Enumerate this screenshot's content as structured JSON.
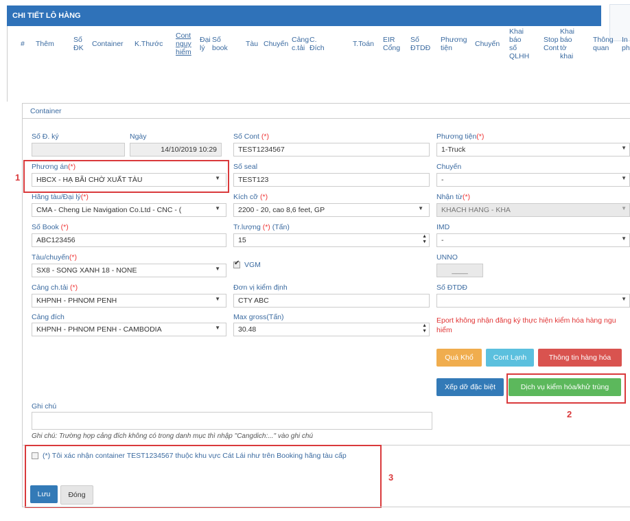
{
  "header": {
    "title": "CHI TIẾT LÔ HÀNG"
  },
  "table_headers": [
    {
      "line1": "#",
      "line2": "",
      "line3": "",
      "line4": "",
      "key": "hash"
    },
    {
      "line1": "Thêm",
      "line2": "",
      "line3": "",
      "line4": "",
      "key": "them"
    },
    {
      "line1": "Số",
      "line2": "ĐK",
      "line3": "",
      "line4": "",
      "key": "so_dk"
    },
    {
      "line1": "Container",
      "line2": "",
      "line3": "",
      "line4": "",
      "key": "container"
    },
    {
      "line1": "K.Thước",
      "line2": "",
      "line3": "",
      "line4": "",
      "key": "kthuoc"
    },
    {
      "line1": "Cont",
      "line2": "nguy",
      "line3": "hiểm",
      "line4": "",
      "key": "cont_nguy_hiem"
    },
    {
      "line1": "Đại",
      "line2": "lý",
      "line3": "",
      "line4": "",
      "key": "dai_ly"
    },
    {
      "line1": "Số",
      "line2": "book",
      "line3": "",
      "line4": "",
      "key": "so_book"
    },
    {
      "line1": "Tàu",
      "line2": "",
      "line3": "",
      "line4": "",
      "key": "tau"
    },
    {
      "line1": "Chuyến",
      "line2": "",
      "line3": "",
      "line4": "",
      "key": "chuyen"
    },
    {
      "line1": "Cảng",
      "line2": "c.tải",
      "line3": "",
      "line4": "",
      "key": "cang_ctai"
    },
    {
      "line1": "C.",
      "line2": "Đích",
      "line3": "",
      "line4": "",
      "key": "c_dich"
    },
    {
      "line1": "T.Toán",
      "line2": "",
      "line3": "",
      "line4": "",
      "key": "ttoan"
    },
    {
      "line1": "EIR",
      "line2": "Cổng",
      "line3": "",
      "line4": "",
      "key": "eir_cong"
    },
    {
      "line1": "Số",
      "line2": "ĐTDĐ",
      "line3": "",
      "line4": "",
      "key": "so_dtdd"
    },
    {
      "line1": "Phương",
      "line2": "tiện",
      "line3": "",
      "line4": "",
      "key": "phuong_tien"
    },
    {
      "line1": "Chuyến",
      "line2": "",
      "line3": "",
      "line4": "",
      "key": "chuyen2"
    },
    {
      "line1": "Khai",
      "line2": "báo",
      "line3": "số",
      "line4": "QLHH",
      "key": "khai_bao_qlhh"
    },
    {
      "line1": "Stop",
      "line2": "Cont",
      "line3": "",
      "line4": "",
      "key": "stop_cont"
    },
    {
      "line1": "Khai",
      "line2": "báo",
      "line3": "tờ",
      "line4": "khai",
      "key": "khai_bao_to_khai"
    },
    {
      "line1": "Thông",
      "line2": "quan",
      "line3": "",
      "line4": "",
      "key": "thong_quan"
    },
    {
      "line1": "In",
      "line2": "ph",
      "line3": "",
      "line4": "",
      "key": "in_ph"
    }
  ],
  "fieldset": {
    "title": "Container"
  },
  "form": {
    "so_dky": {
      "label": "Số Đ. ký",
      "value": ""
    },
    "ngay": {
      "label": "Ngày",
      "value": "14/10/2019 10:29"
    },
    "so_cont": {
      "label": "Số Cont",
      "req": "(*)",
      "value": "TEST1234567"
    },
    "phuong_tien": {
      "label": "Phương tiện",
      "req": "(*)",
      "value": "1-Truck"
    },
    "phuong_an": {
      "label": "Phương án",
      "req": "(*)",
      "value": "HBCX - HẠ BÃI CHỜ XUẤT TÀU"
    },
    "so_seal": {
      "label": "Số seal",
      "value": "TEST123"
    },
    "chuyen": {
      "label": "Chuyến",
      "value": "-"
    },
    "hang_tau": {
      "label": "Hãng tàu/Đại lý",
      "req": "(*)",
      "value": "CMA - Cheng Lie Navigation Co.Ltd - CNC - ("
    },
    "kich_co": {
      "label": "Kích cỡ",
      "req": "(*)",
      "value": "2200 - 20, cao 8,6 feet, GP"
    },
    "nhan_tu": {
      "label": "Nhận từ",
      "req": "(*)",
      "value": "KHACH HANG - KHA"
    },
    "so_book": {
      "label": "Số Book",
      "req": "(*)",
      "value": "ABC123456"
    },
    "tr_luong": {
      "label": "Tr.lượng",
      "req": "(*)",
      "unit": "(Tấn)",
      "value": "15"
    },
    "imd": {
      "label": "IMD",
      "value": "-"
    },
    "tau_chuyen": {
      "label": "Tàu/chuyến",
      "req": "(*)",
      "value": "SX8 - SONG XANH 18 - NONE"
    },
    "vgm": {
      "label": "VGM"
    },
    "unno": {
      "label": "UNNO",
      "value": "____"
    },
    "cang_ctai": {
      "label": "Cảng ch.tải",
      "req": "(*)",
      "value": "KHPNH - PHNOM PENH"
    },
    "don_vi": {
      "label": "Đơn vị kiểm định",
      "value": "CTY ABC"
    },
    "so_dtdd": {
      "label": "Số ĐTDĐ",
      "value": ""
    },
    "cang_dich": {
      "label": "Cảng đích",
      "value": "KHPNH - PHNOM PENH - CAMBODIA"
    },
    "max_gross": {
      "label": "Max gross(Tấn)",
      "value": "30.48"
    },
    "eport_warning": "Eport không nhận đăng ký thực hiện kiểm hóa hàng ngu",
    "eport_warning2": "hiểm",
    "ghi_chu": {
      "label": "Ghi chú",
      "value": "",
      "note": "Ghi chú: Trường hợp cảng đích không có trong danh mục thì nhập \"Cangdich:...\" vào ghi chú"
    },
    "confirm": "(*) Tôi xác nhận container TEST1234567 thuộc khu vực Cát Lái như trên Booking hãng tàu cấp"
  },
  "buttons": {
    "qua_kho": "Quá Khổ",
    "cont_lanh": "Cont Lạnh",
    "thong_tin": "Thông tin hàng hóa",
    "xep_do": "Xếp dỡ đặc biệt",
    "dich_vu": "Dịch vụ kiểm hóa/khử trùng",
    "luu": "Lưu",
    "dong": "Đóng"
  },
  "annotations": {
    "n1": "1",
    "n2": "2",
    "n3": "3"
  },
  "colors": {
    "header": "#2f72b9",
    "label": "#3a6aa0",
    "required": "#e33",
    "annotation": "#d9393b",
    "orange": "#f0ad4e",
    "teal": "#5bc0de",
    "red": "#d9534f",
    "blue": "#337ab7",
    "green": "#5cb85c"
  }
}
